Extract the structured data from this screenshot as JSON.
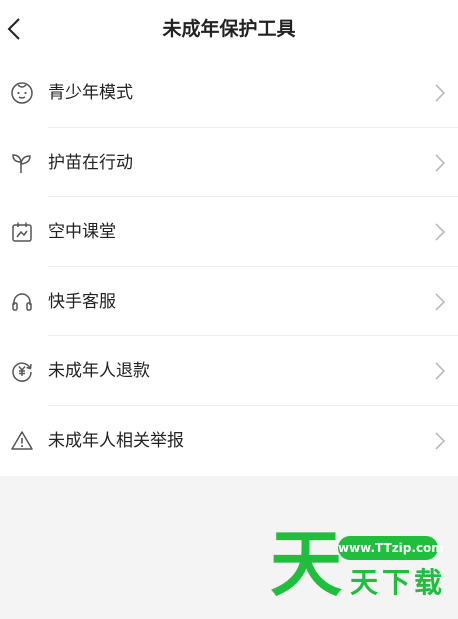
{
  "header": {
    "title": "未成年保护工具",
    "back_icon": "chevron-left-icon"
  },
  "menu": {
    "items": [
      {
        "label": "青少年模式",
        "icon": "baby-face-icon"
      },
      {
        "label": "护苗在行动",
        "icon": "sprout-icon"
      },
      {
        "label": "空中课堂",
        "icon": "calendar-book-icon"
      },
      {
        "label": "快手客服",
        "icon": "headset-icon"
      },
      {
        "label": "未成年人退款",
        "icon": "yuan-refund-icon"
      },
      {
        "label": "未成年人相关举报",
        "icon": "warning-icon"
      }
    ]
  },
  "watermark": {
    "char": "天",
    "url": "www.TTzip.com",
    "text": "天下载",
    "color": "#1fbe3c"
  },
  "colors": {
    "text": "#222222",
    "icon": "#555555",
    "chevron": "#bbbbbb",
    "background": "#f4f4f4"
  }
}
